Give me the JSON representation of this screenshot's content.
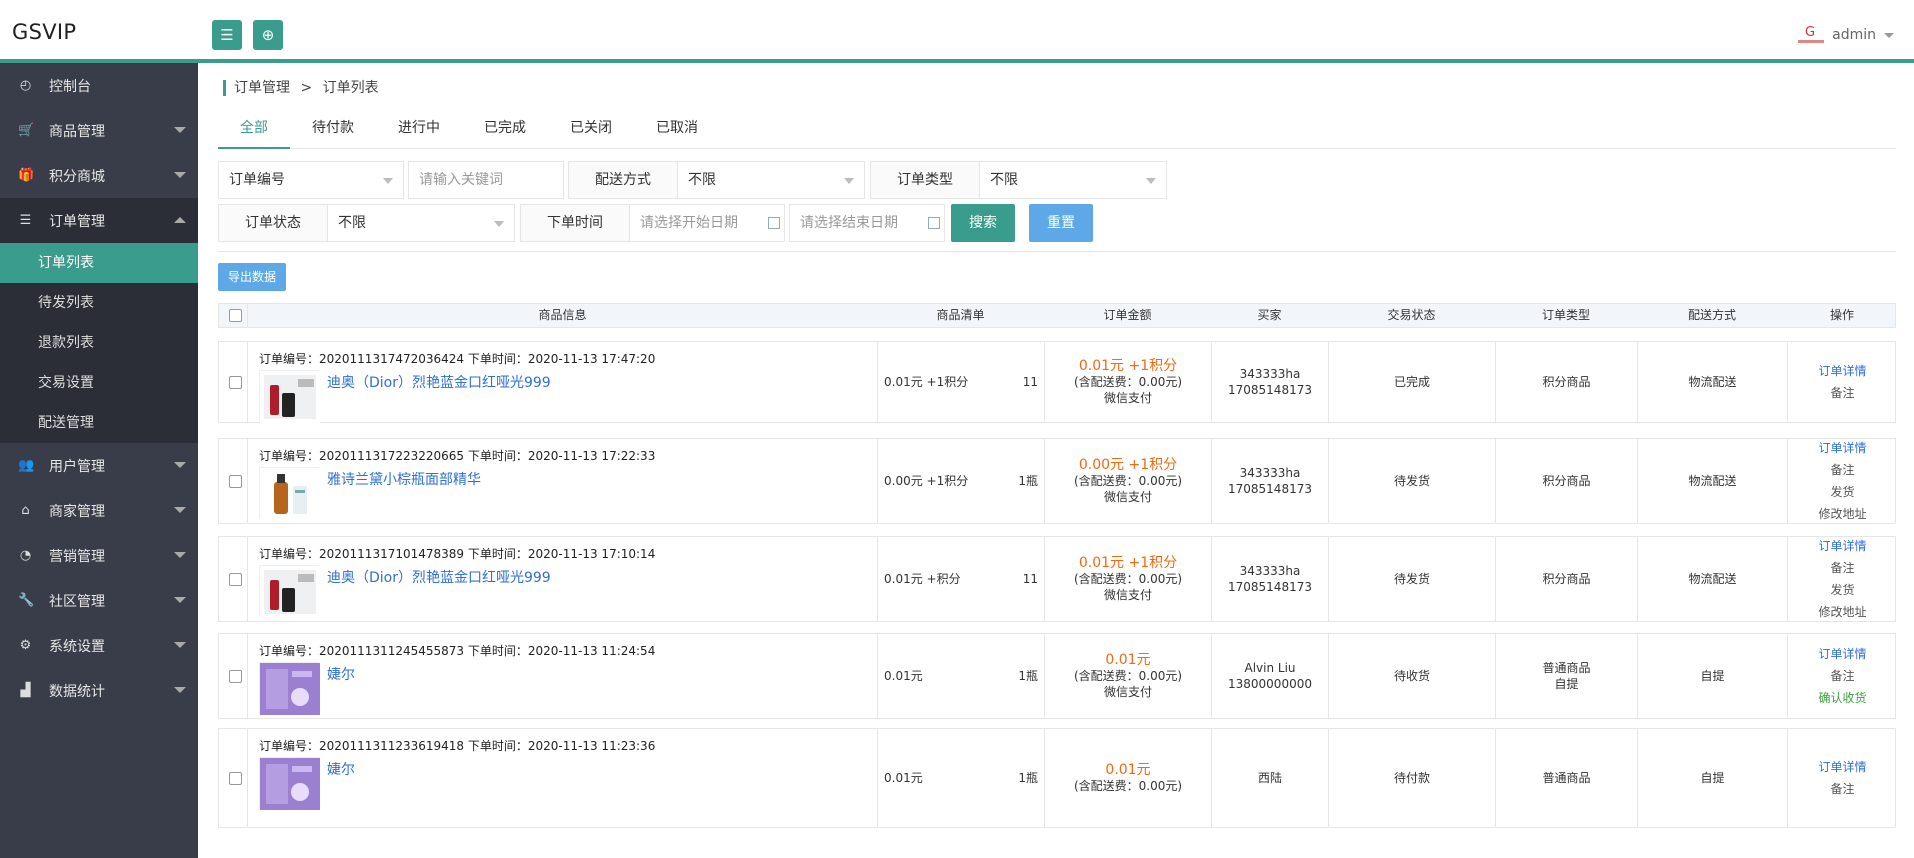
{
  "header": {
    "logo": "GSVIP",
    "user": "admin"
  },
  "sidebar": {
    "items": [
      {
        "label": "控制台",
        "icon": "dashboard-icon",
        "glyph": "◴"
      },
      {
        "label": "商品管理",
        "icon": "cart-icon",
        "glyph": "🛒",
        "arrow": true
      },
      {
        "label": "积分商城",
        "icon": "gift-icon",
        "glyph": "🎁",
        "arrow": true
      },
      {
        "label": "订单管理",
        "icon": "list-icon",
        "glyph": "☰",
        "arrow": true,
        "open": true
      },
      {
        "label": "用户管理",
        "icon": "users-icon",
        "glyph": "👥",
        "arrow": true
      },
      {
        "label": "商家管理",
        "icon": "home-icon",
        "glyph": "⌂",
        "arrow": true
      },
      {
        "label": "营销管理",
        "icon": "dashboard-gauge-icon",
        "glyph": "◔",
        "arrow": true
      },
      {
        "label": "社区管理",
        "icon": "wrench-icon",
        "glyph": "🔧",
        "arrow": true
      },
      {
        "label": "系统设置",
        "icon": "cogs-icon",
        "glyph": "⚙",
        "arrow": true
      },
      {
        "label": "数据统计",
        "icon": "area-chart-icon",
        "glyph": "▟",
        "arrow": true
      }
    ],
    "sub": [
      "订单列表",
      "待发列表",
      "退款列表",
      "交易设置",
      "配送管理"
    ]
  },
  "breadcrumb": {
    "parent": "订单管理",
    "sep": ">",
    "current": "订单列表"
  },
  "tabs": [
    "全部",
    "待付款",
    "进行中",
    "已完成",
    "已关闭",
    "已取消"
  ],
  "filters": {
    "order_field": "订单编号",
    "keyword_placeholder": "请输入关键词",
    "delivery_label": "配送方式",
    "delivery_value": "不限",
    "type_label": "订单类型",
    "type_value": "不限",
    "status_label": "订单状态",
    "status_value": "不限",
    "time_label": "下单时间",
    "start_placeholder": "请选择开始日期",
    "end_placeholder": "请选择结束日期",
    "search": "搜索",
    "reset": "重置",
    "export": "导出数据"
  },
  "columns": [
    "商品信息",
    "商品清单",
    "订单金额",
    "买家",
    "交易状态",
    "订单类型",
    "配送方式",
    "操作"
  ],
  "orders": [
    {
      "header": "订单编号：2020111317472036424 下单时间：2020-11-13 17:47:20",
      "product": "迪奥（Dior）烈艳蓝金口红哑光999",
      "thumb": "lipstick",
      "list_price": "0.01元 +1积分",
      "qty": "11",
      "amount": "0.01元 +1积分",
      "fee": "(含配送费：0.00元)",
      "pay": "微信支付",
      "buyer_name": "343333ha",
      "buyer_phone": "17085148173",
      "status": "已完成",
      "type1": "积分商品",
      "type2": "",
      "delivery": "物流配送",
      "ops": [
        "订单详情",
        "备注"
      ]
    },
    {
      "header": "订单编号：2020111317223220665 下单时间：2020-11-13 17:22:33",
      "product": "雅诗兰黛小棕瓶面部精华",
      "thumb": "serum",
      "list_price": "0.00元 +1积分",
      "qty": "1瓶",
      "amount": "0.00元 +1积分",
      "fee": "(含配送费：0.00元)",
      "pay": "微信支付",
      "buyer_name": "343333ha",
      "buyer_phone": "17085148173",
      "status": "待发货",
      "type1": "积分商品",
      "type2": "",
      "delivery": "物流配送",
      "ops": [
        "订单详情",
        "备注",
        "发货",
        "修改地址"
      ]
    },
    {
      "header": "订单编号：2020111317101478389 下单时间：2020-11-13 17:10:14",
      "product": "迪奥（Dior）烈艳蓝金口红哑光999",
      "thumb": "lipstick",
      "list_price": "0.01元 +积分",
      "qty": "11",
      "amount": "0.01元 +1积分",
      "fee": "(含配送费：0.00元)",
      "pay": "微信支付",
      "buyer_name": "343333ha",
      "buyer_phone": "17085148173",
      "status": "待发货",
      "type1": "积分商品",
      "type2": "",
      "delivery": "物流配送",
      "ops": [
        "订单详情",
        "备注",
        "发货",
        "修改地址"
      ]
    },
    {
      "header": "订单编号：2020111311245455873 下单时间：2020-11-13 11:24:54",
      "product": "婕尔",
      "thumb": "purple",
      "list_price": "0.01元",
      "qty": "1瓶",
      "amount": "0.01元",
      "fee": "(含配送费：0.00元)",
      "pay": "微信支付",
      "buyer_name": "Alvin Liu",
      "buyer_phone": "13800000000",
      "status": "待收货",
      "type1": "普通商品",
      "type2": "自提",
      "delivery": "自提",
      "ops": [
        "订单详情",
        "备注",
        "确认收货"
      ]
    },
    {
      "header": "订单编号：2020111311233619418 下单时间：2020-11-13 11:23:36",
      "product": "婕尔",
      "thumb": "purple",
      "list_price": "0.01元",
      "qty": "1瓶",
      "amount": "0.01元",
      "fee": "(含配送费：0.00元)",
      "pay": "",
      "buyer_name": "西陆",
      "buyer_phone": "",
      "status": "待付款",
      "type1": "普通商品",
      "type2": "",
      "delivery": "自提",
      "ops": [
        "订单详情",
        "备注"
      ]
    }
  ]
}
